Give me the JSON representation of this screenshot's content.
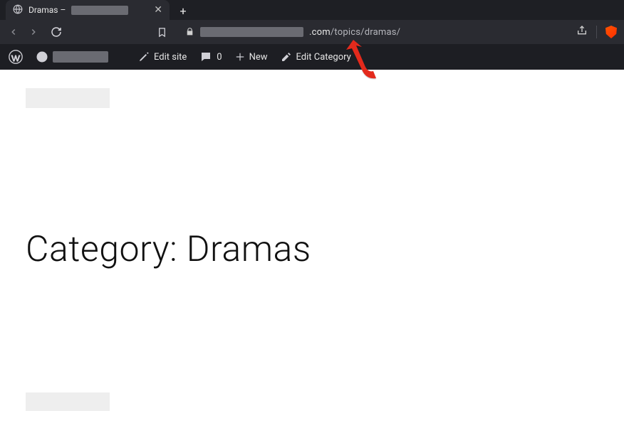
{
  "browser": {
    "tab_title_prefix": "Dramas –",
    "url_domain_visible_fragment": ".com",
    "url_path": "/topics/dramas/"
  },
  "wp_admin": {
    "edit_site_label": "Edit site",
    "comments_count": "0",
    "new_label": "New",
    "edit_category_label": "Edit Category"
  },
  "page": {
    "heading": "Category: Dramas"
  }
}
